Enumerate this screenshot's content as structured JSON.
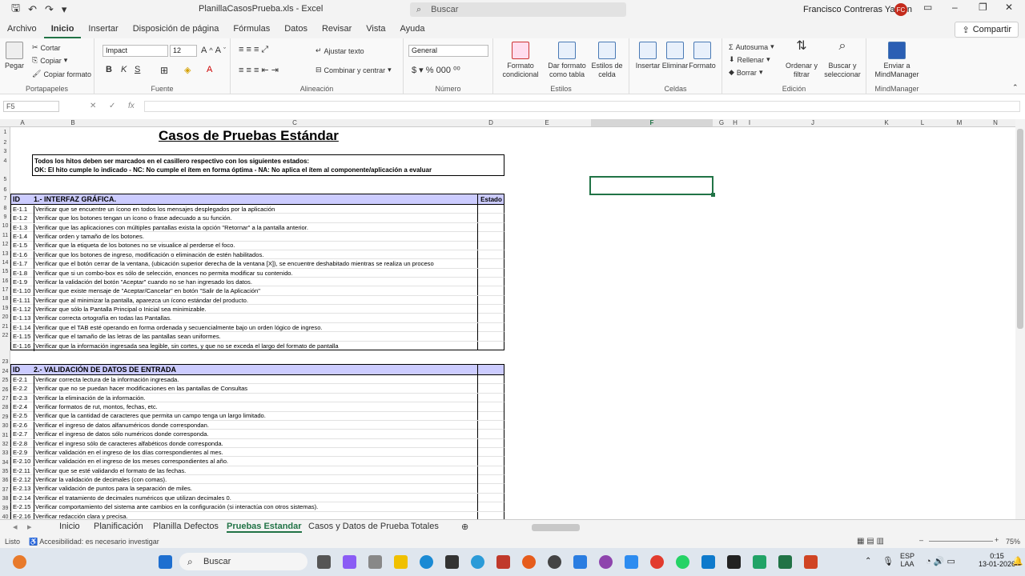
{
  "window": {
    "title": "PlanillaCasosPrueba.xls  -  Excel",
    "search_placeholder": "Buscar",
    "user": "Francisco Contreras Yanten",
    "user_initials": "FC"
  },
  "menu_tabs": [
    "Archivo",
    "Inicio",
    "Insertar",
    "Disposición de página",
    "Fórmulas",
    "Datos",
    "Revisar",
    "Vista",
    "Ayuda"
  ],
  "share_label": "Compartir",
  "ribbon": {
    "paste": "Pegar",
    "cut": "Cortar",
    "copy": "Copiar",
    "format_painter": "Copiar formato",
    "clipboard_group": "Portapapeles",
    "font_name": "Impact",
    "font_size": "12",
    "font_group": "Fuente",
    "wrap_text": "Ajustar texto",
    "merge_center": "Combinar y centrar",
    "alignment_group": "Alineación",
    "number_format": "General",
    "number_group": "Número",
    "cond_format": "Formato condicional",
    "format_table": "Dar formato como tabla",
    "cell_styles": "Estilos de celda",
    "styles_group": "Estilos",
    "insert": "Insertar",
    "delete": "Eliminar",
    "format": "Formato",
    "cells_group": "Celdas",
    "autosum": "Autosuma",
    "fill": "Rellenar",
    "clear": "Borrar",
    "sort_filter": "Ordenar y filtrar",
    "find_select": "Buscar y seleccionar",
    "editing_group": "Edición",
    "mindmanager": "Enviar a MindManager",
    "mindmanager_group": "MindManager"
  },
  "formula_bar": {
    "name_box": "F5",
    "fx": "fx"
  },
  "columns": [
    "A",
    "B",
    "C",
    "D",
    "E",
    "F",
    "G",
    "H",
    "I",
    "J",
    "K",
    "L",
    "M",
    "N"
  ],
  "sheet": {
    "title": "Casos de Pruebas Estándar",
    "note_line1": "Todos los hitos deben ser marcados en el casillero respectivo con los siguientes estados:",
    "note_line2": "OK: El hito cumple lo indicado  -  NC: No cumple el ítem en forma óptima  -  NA: No aplica el ítem al componente/aplicación a evaluar",
    "sections": [
      {
        "id_header": "ID",
        "title": "1.- INTERFAZ GRÁFICA.",
        "status_header": "Estado",
        "rows": [
          {
            "id": "E-1.1",
            "text": "Verificar que se encuentre un ícono en todos los mensajes desplegados por la aplicación"
          },
          {
            "id": "E-1.2",
            "text": "Verificar que los botones tengan un ícono o frase adecuado a su función."
          },
          {
            "id": "E-1.3",
            "text": "Verificar que las aplicaciones con múltiples pantallas exista la opción \"Retornar\" a la pantalla anterior."
          },
          {
            "id": "E-1.4",
            "text": "Verificar orden y tamaño de los botones."
          },
          {
            "id": "E-1.5",
            "text": "Verificar que la etiqueta de los botones no se visualice al perderse el foco."
          },
          {
            "id": "E-1.6",
            "text": "Verificar que los botones de ingreso, modificación o eliminación de estén habilitados."
          },
          {
            "id": "E-1.7",
            "text": "Verificar que el botón cerrar de la ventana, (ubicación superior derecha de la ventana [X]), se encuentre deshabitado mientras se realiza un proceso"
          },
          {
            "id": "E-1.8",
            "text": "Verificar que si un combo-box es sólo de selección, enonces no permita modificar su contenido."
          },
          {
            "id": "E-1.9",
            "text": "Verificar la validación del botón \"Aceptar\" cuando no se han ingresado los datos."
          },
          {
            "id": "E-1.10",
            "text": "Verificar que existe mensaje de \"Aceptar/Cancelar\" en botón \"Salir de la Aplicación\""
          },
          {
            "id": "E-1.11",
            "text": "Verificar que al minimizar la pantalla, aparezca un ícono estándar del producto."
          },
          {
            "id": "E-1.12",
            "text": "Verificar que sólo la Pantalla Principal o Inicial sea minimizable."
          },
          {
            "id": "E-1.13",
            "text": "Verificar correcta ortografía en todas las Pantallas."
          },
          {
            "id": "E-1.14",
            "text": "Verificar que el TAB esté operando en forma ordenada y secuencialmente bajo un orden lógico de ingreso."
          },
          {
            "id": "E-1.15",
            "text": "Verificar que el tamaño de las letras de las pantallas sean uniformes."
          },
          {
            "id": "E-1.16",
            "text": "Verificar que la información ingresada sea legible, sin cortes, y que no se exceda el largo del formato de pantalla"
          }
        ]
      },
      {
        "id_header": "ID",
        "title": "2.- VALIDACIÓN DE DATOS DE ENTRADA",
        "status_header": "",
        "rows": [
          {
            "id": "E-2.1",
            "text": "Verificar correcta lectura de la información ingresada."
          },
          {
            "id": "E-2.2",
            "text": "Verificar que no se puedan hacer modificaciones en las pantallas de Consultas"
          },
          {
            "id": "E-2.3",
            "text": "Verificar la eliminación de la información."
          },
          {
            "id": "E-2.4",
            "text": "Verificar formatos de rut, montos, fechas, etc."
          },
          {
            "id": "E-2.5",
            "text": "Verificar que la cantidad de caracteres que permita un campo tenga un largo limitado."
          },
          {
            "id": "E-2.6",
            "text": "Verificar el ingreso de datos alfanuméricos donde correspondan."
          },
          {
            "id": "E-2.7",
            "text": "Verificar el ingreso de datos sólo numéricos donde corresponda."
          },
          {
            "id": "E-2.8",
            "text": "Verificar el ingreso sólo de caracteres alfabéticos donde corresponda."
          },
          {
            "id": "E-2.9",
            "text": "Verificar validación en el ingreso de los días correspondientes al mes."
          },
          {
            "id": "E-2.10",
            "text": "Verificar validación en el ingreso de los meses correspondientes al año."
          },
          {
            "id": "E-2.11",
            "text": "Verificar que se esté validando el formato de las fechas."
          },
          {
            "id": "E-2.12",
            "text": "Verificar la validación de decimales (con comas)."
          },
          {
            "id": "E-2.13",
            "text": "Verificar validación de puntos para la separación de miles."
          },
          {
            "id": "E-2.14",
            "text": "Verificar el tratamiento de decimales numéricos que utilizan decimales 0."
          },
          {
            "id": "E-2.15",
            "text": "Verificar comportamiento del sistema ante cambios en la configuración (si interactúa con otros sistemas)."
          },
          {
            "id": "E-2.16",
            "text": "Verificar redacción clara y precisa."
          }
        ]
      }
    ]
  },
  "sheet_tabs": [
    "Inicio",
    "Planificación",
    "Planilla Defectos",
    "Pruebas Estandar",
    "Casos y Datos de Prueba",
    "Totales"
  ],
  "active_sheet": "Pruebas Estandar",
  "status": {
    "ready": "Listo",
    "accessibility": "Accesibilidad: es necesario investigar",
    "zoom": "75%"
  },
  "taskbar": {
    "search": "Buscar",
    "lang1": "ESP",
    "lang2": "LAA",
    "time": "0:15",
    "date": "13-01-2026"
  },
  "colors": {
    "accent": "#217346",
    "section_header": "#ccccff"
  }
}
